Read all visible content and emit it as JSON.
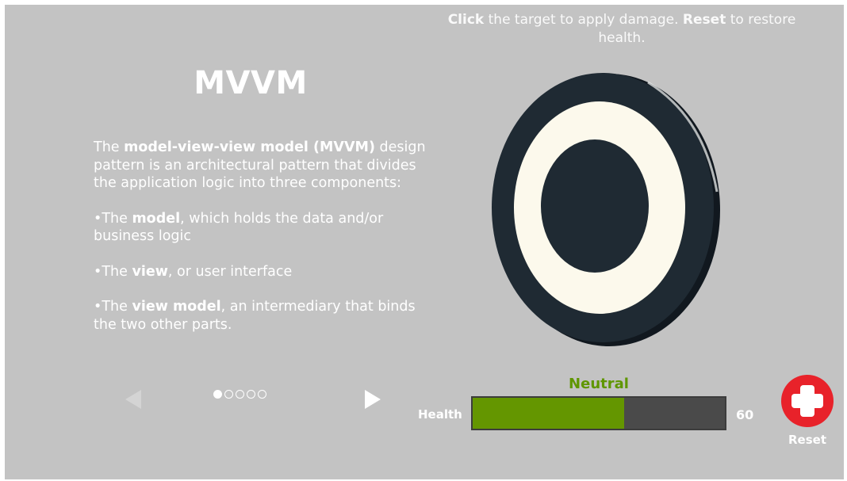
{
  "hint": {
    "click_word": "Click",
    "text1": " the target to apply damage. ",
    "reset_word": "Reset",
    "text2": " to restore health."
  },
  "panel": {
    "title": "MVVM",
    "intro_pre": "The ",
    "intro_bold": "model-view-view model (MVVM)",
    "intro_post": " design pattern is an architectural pattern that divides the application logic into three components:",
    "bullets": [
      {
        "pre": "•The ",
        "bold": "model",
        "post": ", which holds the data and/or business logic"
      },
      {
        "pre": "•The ",
        "bold": "view",
        "post": ", or user interface"
      },
      {
        "pre": "•The ",
        "bold": "view model",
        "post": ", an intermediary that binds the two other parts."
      }
    ],
    "pagination": {
      "total": 5,
      "current": 1
    },
    "prev_icon": "triangle-left-icon",
    "next_icon": "triangle-right-icon"
  },
  "target": {
    "icon": "bullseye-target-icon"
  },
  "health": {
    "status": "Neutral",
    "label": "Health",
    "value": "60",
    "fraction": 0.6,
    "fill_color": "#649600",
    "status_color": "#5f9600"
  },
  "reset": {
    "label": "Reset",
    "icon": "red-cross-icon",
    "color": "#e8222a"
  },
  "colors": {
    "background": "#c3c3c3",
    "disc": "#1f2a33",
    "ring": "#fcf9ec"
  }
}
